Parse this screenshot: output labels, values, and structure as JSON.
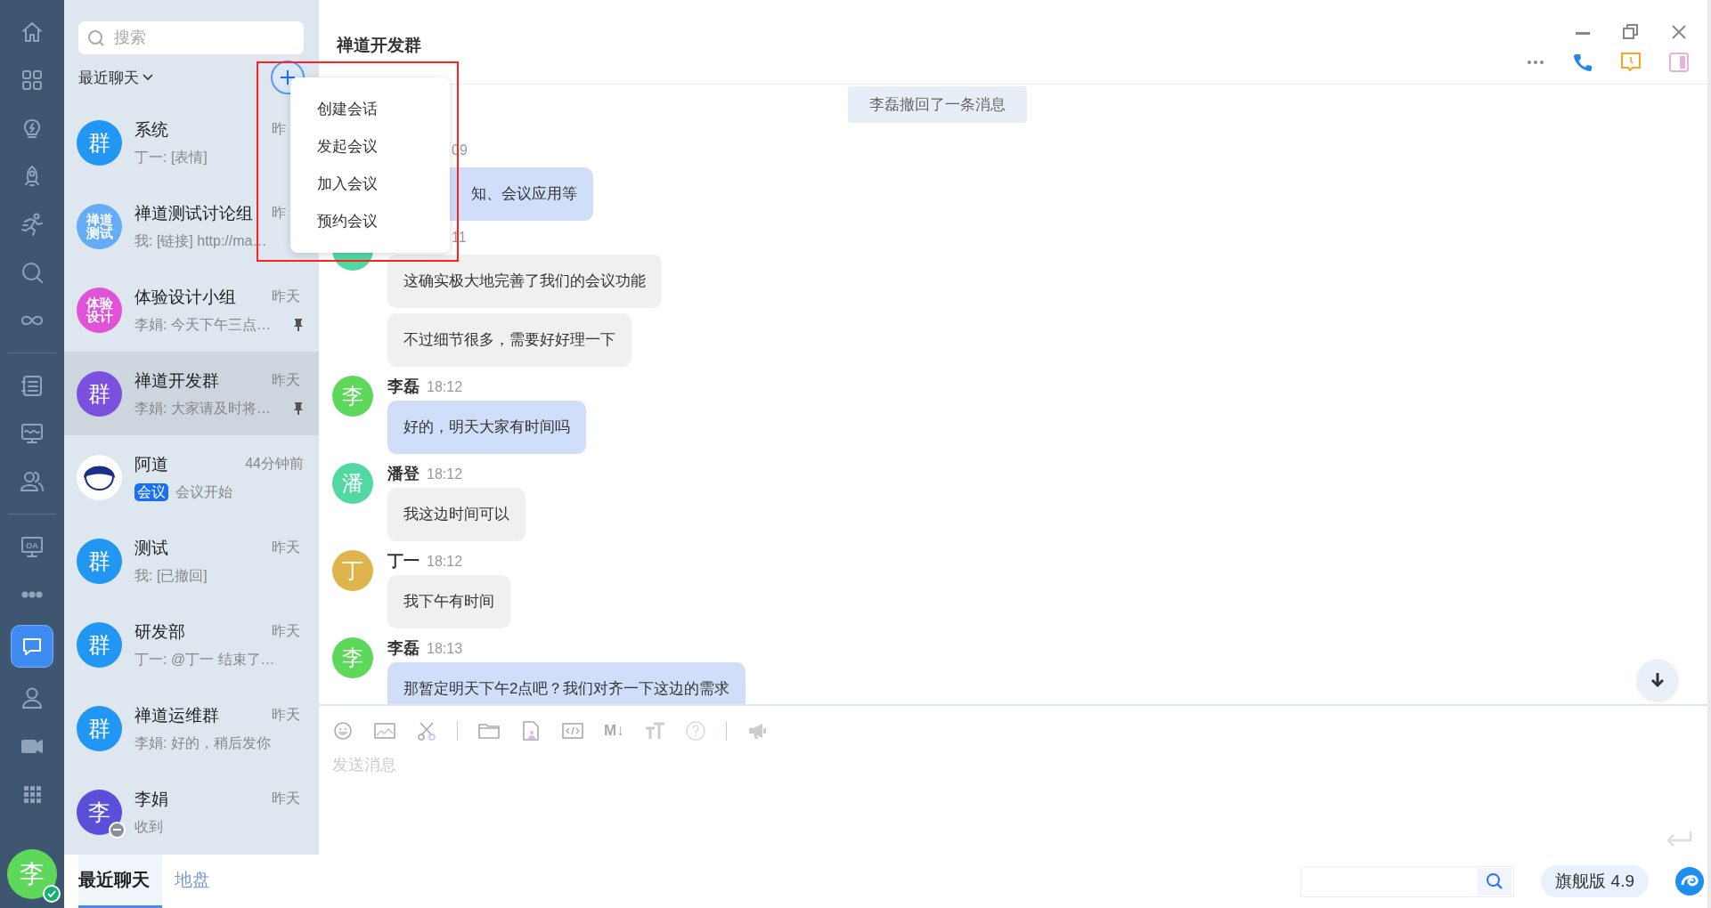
{
  "rail": {
    "groups": [
      [
        {
          "kind": "home",
          "selected": false
        },
        {
          "kind": "apps",
          "selected": false
        },
        {
          "kind": "bulb",
          "selected": false
        },
        {
          "kind": "rocket",
          "selected": false
        },
        {
          "kind": "runner",
          "selected": false
        },
        {
          "kind": "search",
          "selected": false
        },
        {
          "kind": "infinity",
          "selected": false
        }
      ],
      [
        {
          "kind": "list",
          "selected": false
        },
        {
          "kind": "monitor",
          "selected": false
        },
        {
          "kind": "users",
          "selected": false
        }
      ],
      [
        {
          "kind": "oa",
          "label": "OA",
          "selected": false
        },
        {
          "kind": "more",
          "selected": false
        },
        {
          "kind": "chat",
          "selected": true
        },
        {
          "kind": "user",
          "selected": false
        },
        {
          "kind": "video",
          "selected": false
        },
        {
          "kind": "grid",
          "selected": false
        }
      ]
    ],
    "user": {
      "initial": "李",
      "online": true
    }
  },
  "chat_list": {
    "search": {
      "placeholder": "搜索"
    },
    "filter": "最近聊天",
    "items": [
      {
        "name": "系统",
        "time": "昨",
        "preview": "丁一: [表情]",
        "avatar": {
          "kind": "text",
          "lines": [
            "群"
          ],
          "color": "#2196f3"
        },
        "pinned": false,
        "selected": false
      },
      {
        "name": "禅道测试讨论组",
        "time": "昨",
        "preview": "我: [链接] http://ma…",
        "avatar": {
          "kind": "text",
          "lines": [
            "禅道",
            "测试"
          ],
          "color": "#64acf6"
        },
        "pinned": false,
        "selected": false
      },
      {
        "name": "体验设计小组",
        "time": "昨天",
        "preview": "李娟: 今天下午三点…",
        "avatar": {
          "kind": "text",
          "lines": [
            "体验",
            "设计"
          ],
          "color": "#e052d8"
        },
        "pinned": true,
        "selected": false
      },
      {
        "name": "禅道开发群",
        "time": "昨天",
        "preview": "李娟: 大家请及时将…",
        "avatar": {
          "kind": "text",
          "lines": [
            "群"
          ],
          "color": "#7c50df"
        },
        "pinned": true,
        "selected": true
      },
      {
        "name": "阿道",
        "time": "44分钟前",
        "tag": "会议",
        "preview": "会议开始",
        "avatar": {
          "kind": "mascot"
        },
        "pinned": false,
        "selected": false
      },
      {
        "name": "测试",
        "time": "昨天",
        "preview": "我: [已撤回]",
        "avatar": {
          "kind": "text",
          "lines": [
            "群"
          ],
          "color": "#2196f3"
        },
        "pinned": false,
        "selected": false
      },
      {
        "name": "研发部",
        "time": "昨天",
        "preview": "丁一: @丁一 结束了…",
        "avatar": {
          "kind": "text",
          "lines": [
            "群"
          ],
          "color": "#2196f3"
        },
        "pinned": false,
        "selected": false
      },
      {
        "name": "禅道运维群",
        "time": "昨天",
        "preview": "李娟: 好的，稍后发你",
        "avatar": {
          "kind": "text",
          "lines": [
            "群"
          ],
          "color": "#2196f3"
        },
        "pinned": false,
        "selected": false
      },
      {
        "name": "李娟",
        "time": "昨天",
        "preview": "收到",
        "avatar": {
          "kind": "text",
          "lines": [
            "李"
          ],
          "color": "#5a4fd8",
          "away": true
        },
        "pinned": false,
        "selected": false
      }
    ],
    "menu": {
      "items": [
        "创建会话",
        "发起会议",
        "加入会议",
        "预约会议"
      ]
    },
    "tabs": [
      {
        "label": "最近聊天",
        "selected": true
      },
      {
        "label": "地盘",
        "selected": false
      }
    ]
  },
  "chat": {
    "title": "禅道开发群",
    "notice": "李磊撤回了一条消息",
    "messages": [
      {
        "obscured": true,
        "time": "09",
        "highlight": true,
        "bubbles": [
          "知、会议应用等"
        ]
      },
      {
        "obscured": true,
        "time": "11",
        "avatar": {
          "color": "#52d9a3"
        },
        "highlight": false,
        "bubbles": [
          "这确实极大地完善了我们的会议功能",
          "不过细节很多，需要好好理一下"
        ]
      },
      {
        "obscured": false,
        "sender": "李磊",
        "time": "18:12",
        "avatar": {
          "text": "李",
          "color": "#5ed85a"
        },
        "highlight": true,
        "bubbles": [
          "好的，明天大家有时间吗"
        ]
      },
      {
        "obscured": false,
        "sender": "潘登",
        "time": "18:12",
        "avatar": {
          "text": "潘",
          "color": "#52d9a3"
        },
        "highlight": false,
        "bubbles": [
          "我这边时间可以"
        ]
      },
      {
        "obscured": false,
        "sender": "丁一",
        "time": "18:12",
        "avatar": {
          "text": "丁",
          "color": "#e0b44c"
        },
        "highlight": false,
        "bubbles": [
          "我下午有时间"
        ]
      },
      {
        "obscured": false,
        "sender": "李磊",
        "time": "18:13",
        "avatar": {
          "text": "李",
          "color": "#5ed85a"
        },
        "highlight": true,
        "bubbles": [
          "那暂定明天下午2点吧？我们对齐一下这边的需求"
        ]
      }
    ],
    "composer": {
      "placeholder": "发送消息",
      "markdown_label": "M↓"
    }
  },
  "status_bar": {
    "edition": "旗舰版 4.9"
  }
}
